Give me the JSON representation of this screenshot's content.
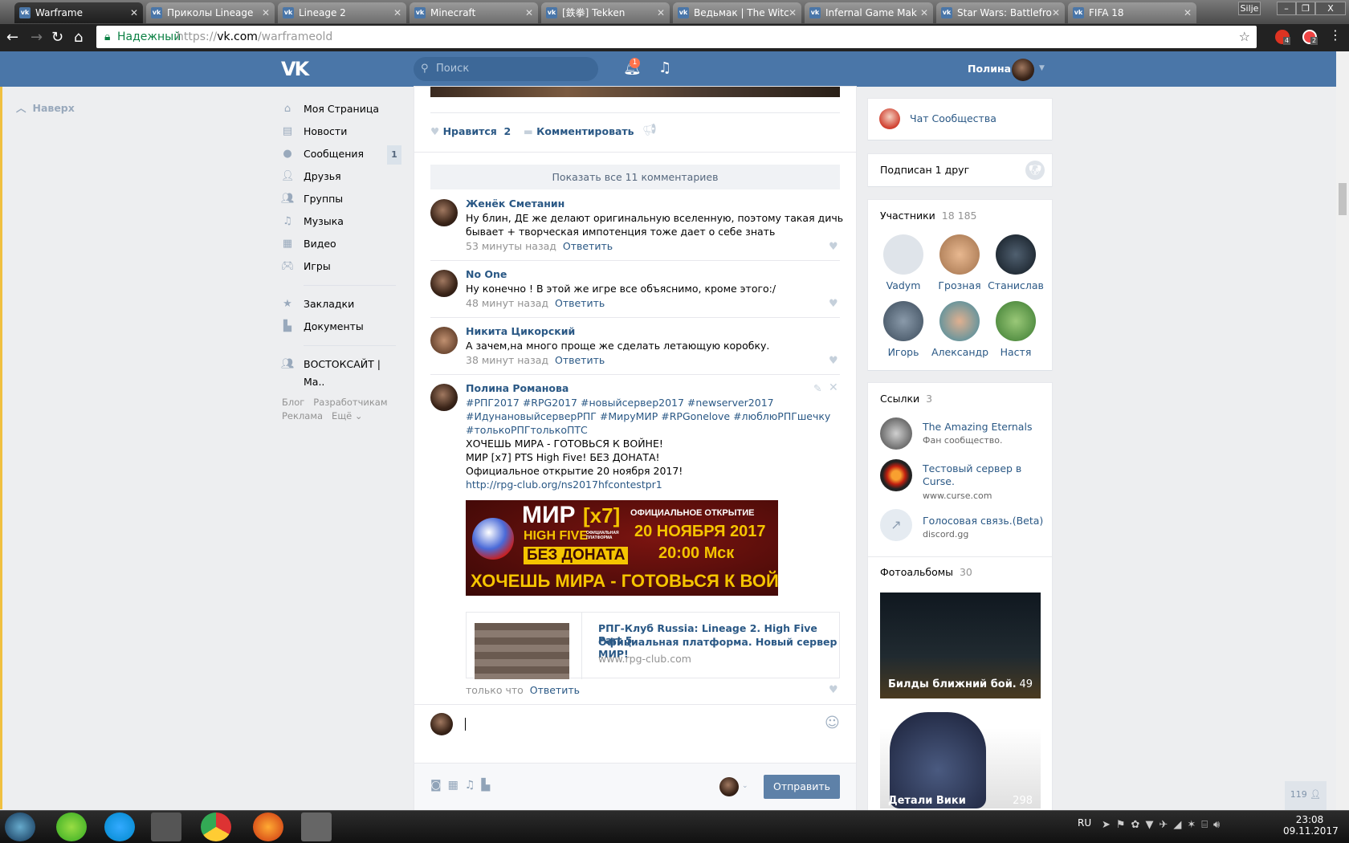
{
  "browser": {
    "tabs": [
      {
        "label": "Warframe"
      },
      {
        "label": "Приколы Lineage"
      },
      {
        "label": "Lineage 2"
      },
      {
        "label": "Minecraft"
      },
      {
        "label": "[鉄拳] Tekken"
      },
      {
        "label": "Ведьмак | The Witc"
      },
      {
        "label": "Infernal Game Mak"
      },
      {
        "label": "Star Wars: Battlefro"
      },
      {
        "label": "FIFA 18"
      }
    ],
    "profile_button": "Silje",
    "secure_label": "Надежный",
    "url_prefix": "https://",
    "url_host": "vk.com",
    "url_path": "/warframeold",
    "ext1_badge": "4",
    "ext2_badge": "2"
  },
  "header": {
    "logo": "VK",
    "search_placeholder": "Поиск",
    "notif_count": "1",
    "user_name": "Полина"
  },
  "left": {
    "back_to_top": "Наверх",
    "nav": [
      {
        "label": "Моя Страница",
        "icon": "home-icon"
      },
      {
        "label": "Новости",
        "icon": "news-icon"
      },
      {
        "label": "Сообщения",
        "icon": "messages-icon",
        "badge": "1"
      },
      {
        "label": "Друзья",
        "icon": "friends-icon"
      },
      {
        "label": "Группы",
        "icon": "groups-icon"
      },
      {
        "label": "Музыка",
        "icon": "music-icon"
      },
      {
        "label": "Видео",
        "icon": "video-icon"
      },
      {
        "label": "Игры",
        "icon": "games-icon"
      }
    ],
    "nav2": [
      {
        "label": "Закладки",
        "icon": "star-icon"
      },
      {
        "label": "Документы",
        "icon": "document-icon"
      }
    ],
    "nav3": [
      {
        "label": "ВОСТОКСАЙТ | Ма..",
        "icon": "groups-icon"
      }
    ],
    "footer": {
      "blog": "Блог",
      "dev": "Разработчикам",
      "ads": "Реклама",
      "more": "Ещё"
    }
  },
  "post": {
    "like_label": "Нравится",
    "like_count": "2",
    "comment_label": "Комментировать",
    "show_all": "Показать все 11 комментариев",
    "comments": [
      {
        "author": "Женёк Сметанин",
        "lines": [
          "Ну блин, ДЕ же делают оригинальную вселенную, поэтому такая дичь",
          "бывает + творческая импотенция тоже дает о себе знать"
        ],
        "time": "53 минуты назад",
        "reply": "Ответить"
      },
      {
        "author": "No One",
        "lines": [
          "Ну конечно ! В этой же игре все объяснимо, кроме этого:/"
        ],
        "time": "48 минут назад",
        "reply": "Ответить"
      },
      {
        "author": "Никита Цикорский",
        "lines": [
          "А зачем,на много проще же сделать летающую коробку."
        ],
        "time": "38 минут назад",
        "reply": "Ответить"
      }
    ],
    "own_comment": {
      "author": "Полина Романова",
      "hashtags": [
        "#РПГ2017 #RPG2017 #новыйсервер2017 #newserver2017",
        "#ИдунановыйсерверРПГ #МируМИР #RPGonelove #люблюРПГшечку",
        "#толькоРПГтолькоПТС"
      ],
      "lines": [
        "ХОЧЕШЬ МИРА - ГОТОВЬСЯ К ВОЙНЕ!",
        "МИР [x7] PTS High Five! БЕЗ ДОНАТА!",
        "Официальное открытие 20 ноября 2017!"
      ],
      "link": "http://rpg-club.org/ns2017hfcontestpr1",
      "banner": {
        "mir": "МИР",
        "x7": "[x7]",
        "hf": "HIGH FIVE",
        "platform": "ОФИЦИАЛЬНАЯ ПЛАТФОРМА",
        "nodonate": "БЕЗ ДОНАТА",
        "opening": "ОФИЦИАЛЬНОЕ ОТКРЫТИЕ",
        "date": "20 НОЯБРЯ 2017",
        "time": "20:00 Мск",
        "slogan": "ХОЧЕШЬ МИРА - ГОТОВЬСЯ К ВОЙНЕ"
      },
      "card_title1": "РПГ-Клуб Russia: Lineage 2. High Five Part 5",
      "card_title2": "Официальная платформа. Новый сервер МИР!",
      "card_domain": "www.rpg-club.com",
      "time": "только что",
      "reply": "Ответить"
    },
    "send_label": "Отправить"
  },
  "right": {
    "chat": "Чат Сообщества",
    "friend_sub": "Подписан 1 друг",
    "members_title": "Участники",
    "members_count": "18 185",
    "members": [
      {
        "name": "Vadym"
      },
      {
        "name": "Грозная"
      },
      {
        "name": "Станислав"
      },
      {
        "name": "Игорь"
      },
      {
        "name": "Александр"
      },
      {
        "name": "Настя"
      }
    ],
    "links_title": "Ссылки",
    "links_count": "3",
    "links": [
      {
        "title": "The Amazing Eternals",
        "sub": "Фан сообщество."
      },
      {
        "title": "Тестовый сервер в",
        "title2": "Curse.",
        "sub": "www.curse.com"
      },
      {
        "title": "Голосовая связь.(Beta)",
        "sub": "discord.gg"
      }
    ],
    "albums_title": "Фотоальбомы",
    "albums_count": "30",
    "albums": [
      {
        "name": "Билды ближний бой.",
        "count": "49"
      },
      {
        "name": "Детали Вики",
        "count": "298"
      }
    ]
  },
  "online_count": "119",
  "taskbar": {
    "lang": "RU",
    "time": "23:08",
    "date": "09.11.2017"
  },
  "colors": {
    "vk_blue": "#4a76a8",
    "link": "#2a5885",
    "bg": "#edeef0"
  }
}
